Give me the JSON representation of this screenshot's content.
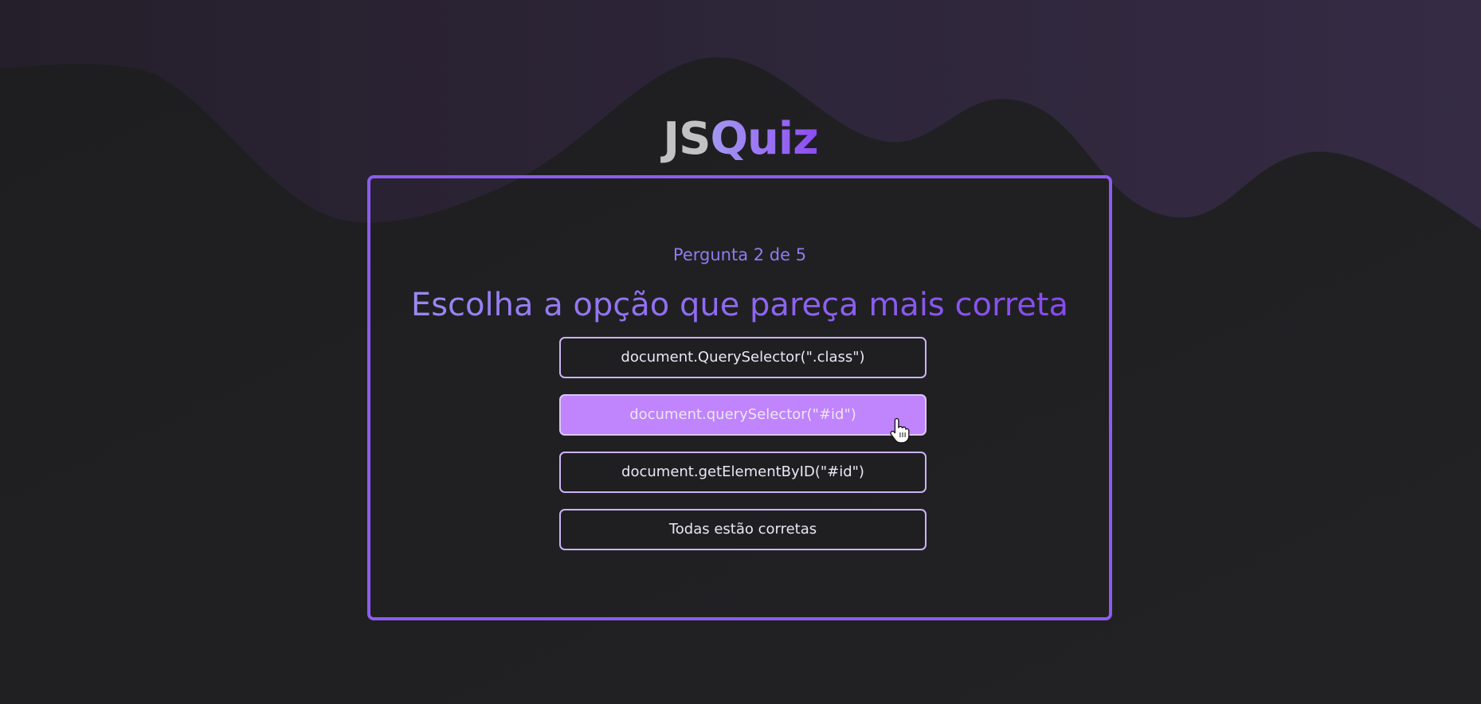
{
  "logo": {
    "part1": "JS",
    "part2": "Quiz"
  },
  "quiz": {
    "counter": "Pergunta 2 de 5",
    "question": "Escolha a opção que pareça mais correta",
    "options": [
      {
        "label": "document.QuerySelector(\".class\")",
        "state": "default"
      },
      {
        "label": "document.querySelector(\"#id\")",
        "state": "hover"
      },
      {
        "label": "document.getElementByID(\"#id\")",
        "state": "default"
      },
      {
        "label": "Todas estão corretas",
        "state": "default"
      }
    ]
  },
  "colors": {
    "background": "#1f1f21",
    "wave_top": "#2d2539",
    "accent": "#8c5cf0",
    "option_hover": "#c084fc",
    "option_border": "#cbb3f3"
  },
  "icons": {
    "cursor": "hand-pointer-icon"
  }
}
